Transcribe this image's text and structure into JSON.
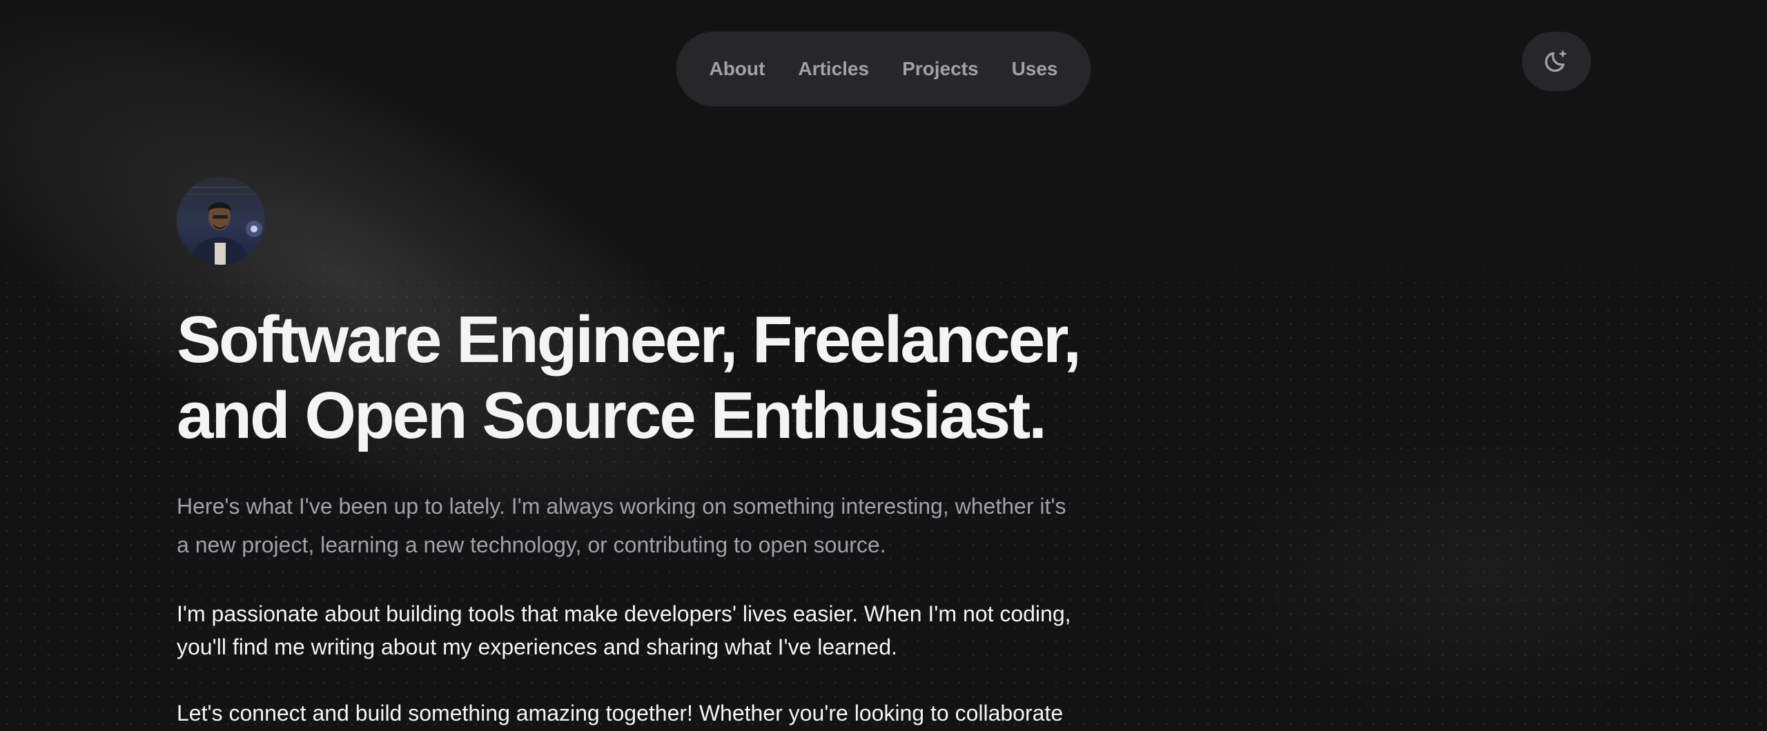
{
  "nav": {
    "items": [
      {
        "label": "About"
      },
      {
        "label": "Articles"
      },
      {
        "label": "Projects"
      },
      {
        "label": "Uses"
      }
    ]
  },
  "theme_toggle": {
    "icon": "moon-sparkle-icon"
  },
  "hero": {
    "title_lines": [
      "Software Engineer, Freelancer,",
      "and Open Source Enthusiast."
    ],
    "lead_lines": [
      "Here's what I've been up to lately. I'm always working on something interesting, whether it's",
      "a new project, learning a new technology, or contributing to open source."
    ],
    "paragraph1_lines": [
      "I'm passionate about building tools that make developers' lives easier. When I'm not coding,",
      "you'll find me writing about my experiences and sharing what I've learned."
    ],
    "paragraph2_lines": [
      "Let's connect and build something amazing together! Whether you're looking to collaborate"
    ]
  },
  "colors": {
    "background": "#131313",
    "nav_bg": "#27272a",
    "muted_text": "#a1a1aa",
    "heading_text": "#f4f4f5"
  }
}
